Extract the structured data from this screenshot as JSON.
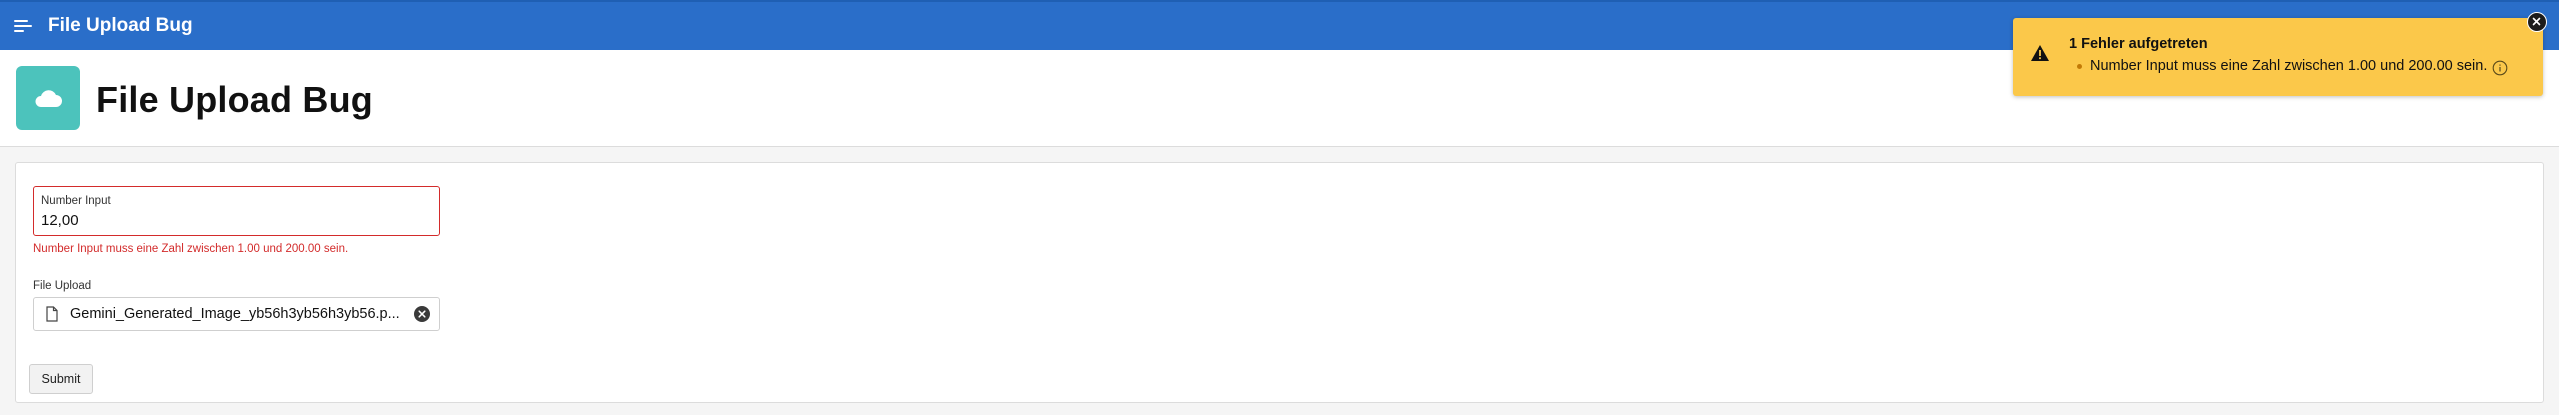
{
  "app": {
    "title": "File Upload Bug",
    "menu_icon": "hamburger-menu-icon"
  },
  "page": {
    "title": "File Upload Bug",
    "icon": "cloud-icon",
    "icon_color": "#4cc3bc"
  },
  "form": {
    "number_input": {
      "label": "Number Input",
      "value": "12,00",
      "error": "Number Input muss eine Zahl zwischen 1.00 und 200.00 sein."
    },
    "file_upload": {
      "label": "File Upload",
      "file_name": "Gemini_Generated_Image_yb56h3yb56h3yb56.p..."
    },
    "submit_label": "Submit"
  },
  "notification": {
    "title": "1 Fehler aufgetreten",
    "message": "Number Input muss eine Zahl zwischen 1.00 und 200.00 sein.",
    "color": "#fbc84a"
  },
  "colors": {
    "topbar": "#2a6ec9",
    "error": "#d32b2b"
  }
}
